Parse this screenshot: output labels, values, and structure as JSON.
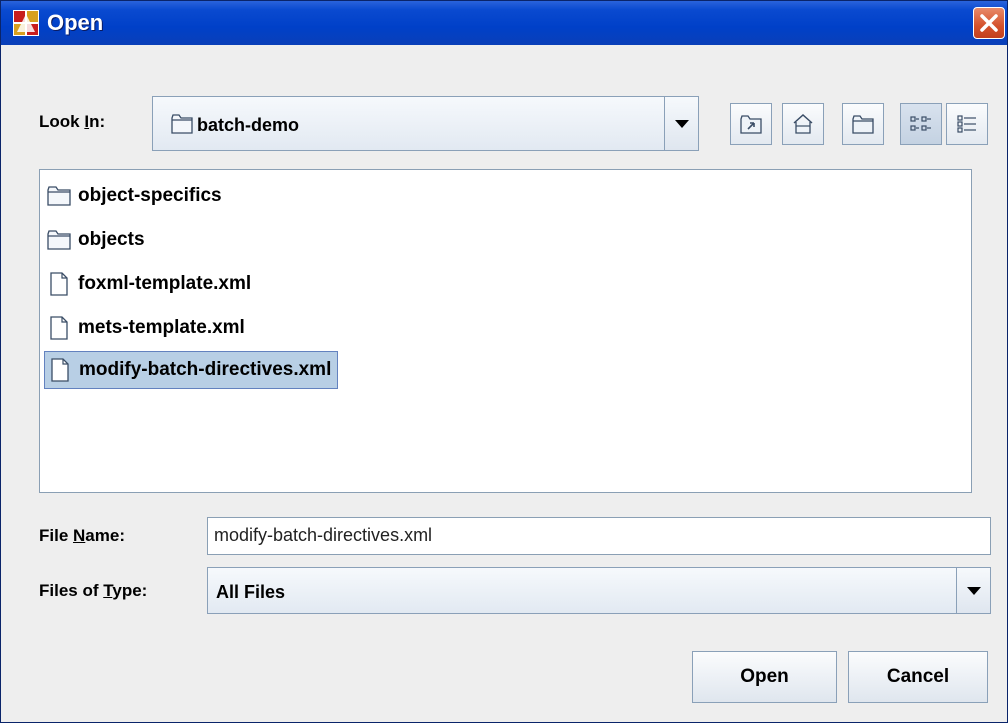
{
  "window": {
    "title": "Open"
  },
  "look_in": {
    "label_pre": "Look ",
    "label_mnemonic": "I",
    "label_post": "n:",
    "value": "batch-demo"
  },
  "toolbar": {
    "icons": [
      "up-one-level-icon",
      "home-icon",
      "new-folder-icon",
      "list-view-icon",
      "details-view-icon"
    ]
  },
  "files": [
    {
      "name": "object-specifics",
      "kind": "folder",
      "selected": false
    },
    {
      "name": "objects",
      "kind": "folder",
      "selected": false
    },
    {
      "name": "foxml-template.xml",
      "kind": "file",
      "selected": false
    },
    {
      "name": "mets-template.xml",
      "kind": "file",
      "selected": false
    },
    {
      "name": "modify-batch-directives.xml",
      "kind": "file",
      "selected": true
    }
  ],
  "file_name": {
    "label_pre": "File ",
    "label_mnemonic": "N",
    "label_post": "ame:",
    "value": "modify-batch-directives.xml"
  },
  "files_of_type": {
    "label_pre": "Files of ",
    "label_mnemonic": "T",
    "label_post": "ype:",
    "value": "All Files"
  },
  "buttons": {
    "open": "Open",
    "cancel": "Cancel"
  },
  "colors": {
    "title_bar": "#0a4ad0",
    "selection": "#b8cfe5",
    "close_button": "#d4512c"
  }
}
